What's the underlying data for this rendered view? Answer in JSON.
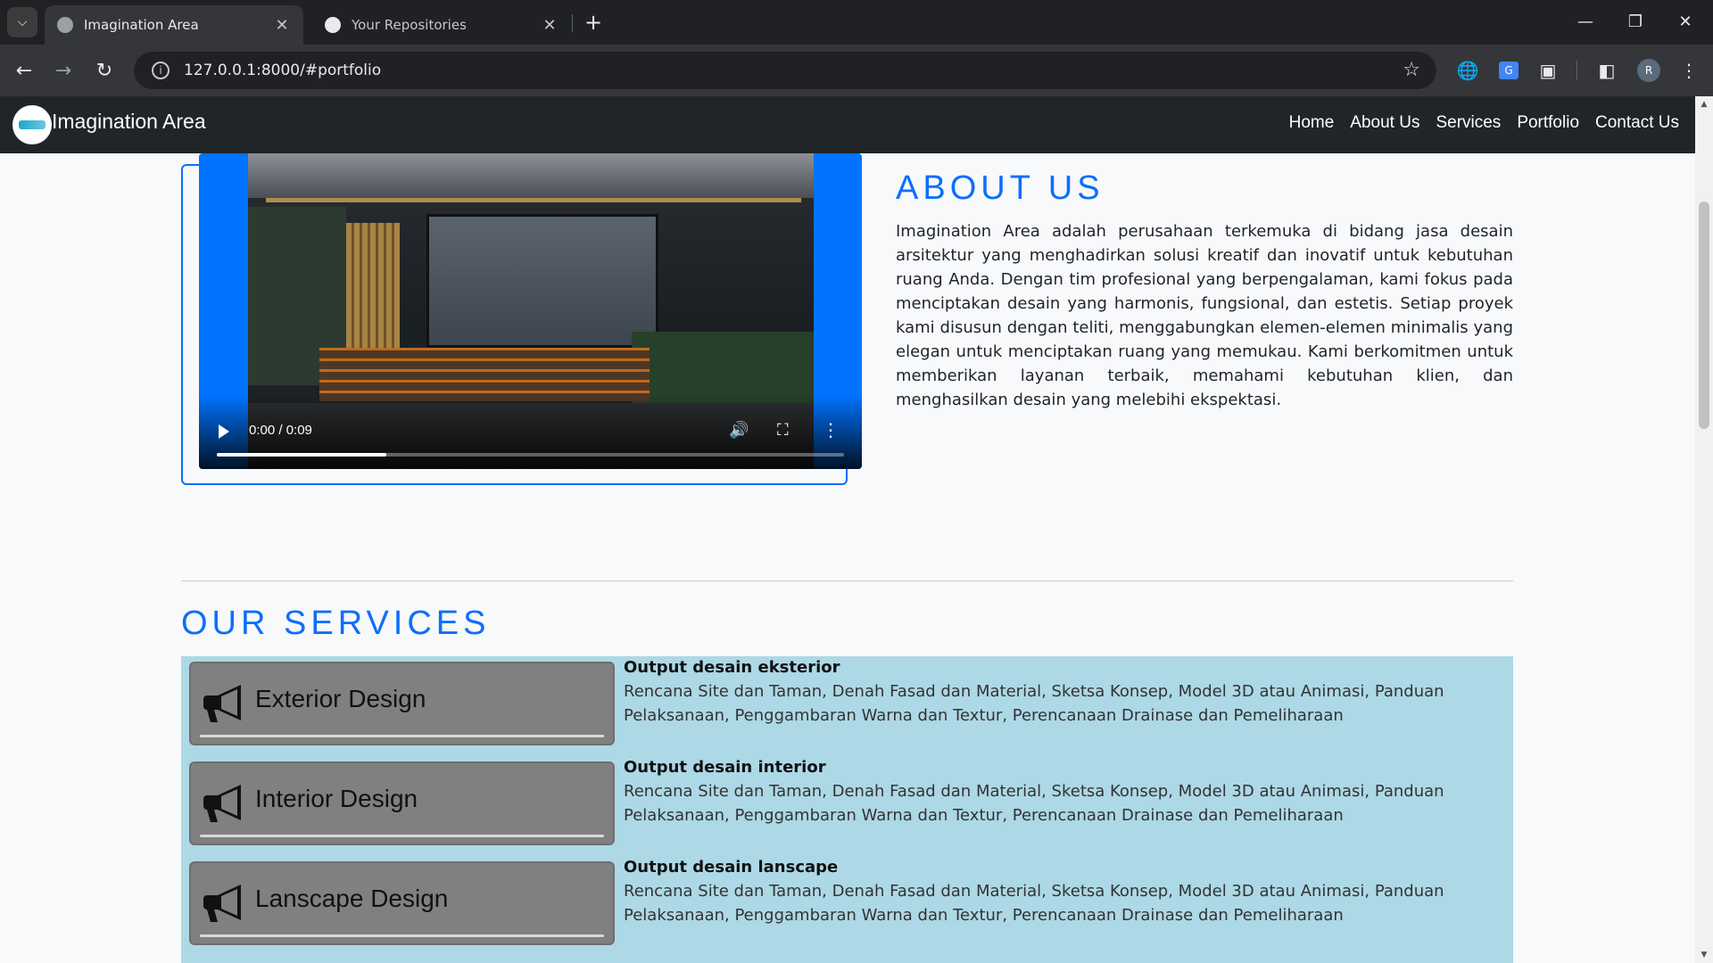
{
  "browser": {
    "tabs": [
      {
        "title": "Imagination Area",
        "active": true
      },
      {
        "title": "Your Repositories",
        "active": false
      }
    ],
    "url": "127.0.0.1:8000/#portfolio",
    "profile_initial": "R"
  },
  "site": {
    "brand": "Imagination Area",
    "nav": [
      "Home",
      "About Us",
      "Services",
      "Portfolio",
      "Contact Us"
    ]
  },
  "video": {
    "time": "0:00 / 0:09",
    "progress_fraction": 0.27
  },
  "about": {
    "title": "ABOUT US",
    "text": "Imagination Area adalah perusahaan terkemuka di bidang jasa desain arsitektur yang menghadirkan solusi kreatif dan inovatif untuk kebutuhan ruang Anda. Dengan tim profesional yang berpengalaman, kami fokus pada menciptakan desain yang harmonis, fungsional, dan estetis. Setiap proyek kami disusun dengan teliti, menggabungkan elemen-elemen minimalis yang elegan untuk menciptakan ruang yang memukau. Kami berkomitmen untuk memberikan layanan terbaik, memahami kebutuhan klien, dan menghasilkan desain yang melebihi ekspektasi."
  },
  "services": {
    "title": "OUR SERVICES",
    "items": [
      {
        "name": "Exterior Design",
        "heading": "Output desain eksterior",
        "desc": "Rencana Site dan Taman, Denah Fasad dan Material, Sketsa Konsep, Model 3D atau Animasi, Panduan Pelaksanaan, Penggambaran Warna dan Textur, Perencanaan Drainase dan Pemeliharaan"
      },
      {
        "name": "Interior Design",
        "heading": "Output desain interior",
        "desc": "Rencana Site dan Taman, Denah Fasad dan Material, Sketsa Konsep, Model 3D atau Animasi, Panduan Pelaksanaan, Penggambaran Warna dan Textur, Perencanaan Drainase dan Pemeliharaan"
      },
      {
        "name": "Lanscape Design",
        "heading": "Output desain lanscape",
        "desc": "Rencana Site dan Taman, Denah Fasad dan Material, Sketsa Konsep, Model 3D atau Animasi, Panduan Pelaksanaan, Penggambaran Warna dan Textur, Perencanaan Drainase dan Pemeliharaan"
      }
    ]
  },
  "colors": {
    "accent": "#0d6efd",
    "navbar": "#212529",
    "services_bg": "#add8e6",
    "service_card": "#808080",
    "video_frame": "#0073ff"
  }
}
